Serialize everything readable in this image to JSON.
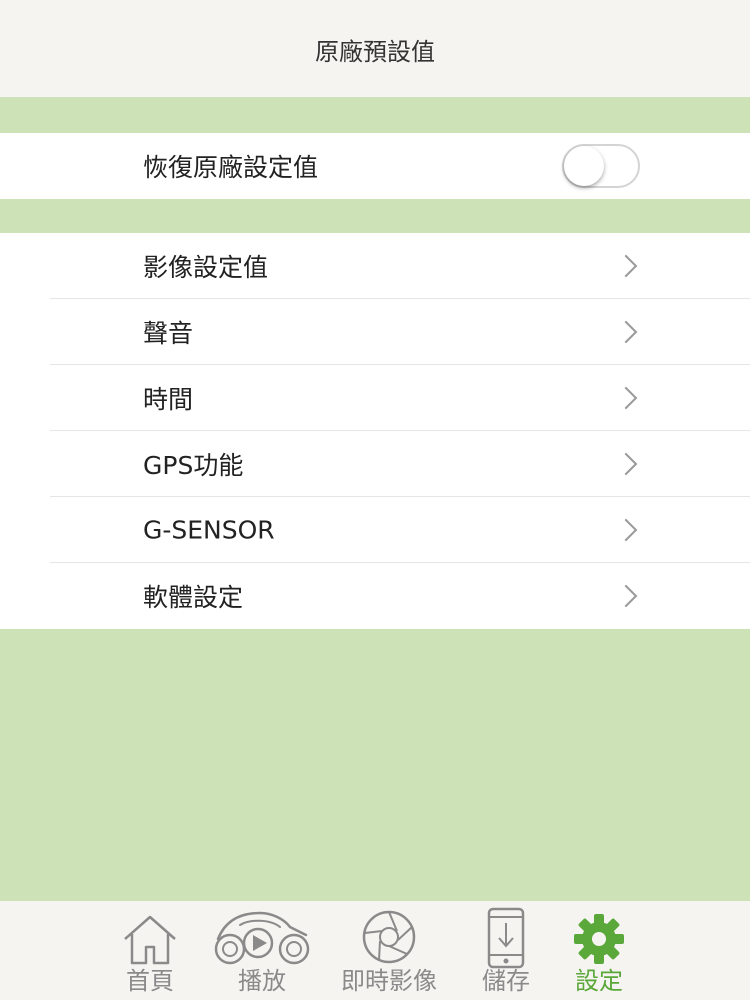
{
  "header": {
    "title": "原廠預設值"
  },
  "reset": {
    "label": "恢復原廠設定值",
    "enabled": false
  },
  "menu": {
    "items": [
      {
        "label": "影像設定值"
      },
      {
        "label": "聲音"
      },
      {
        "label": "時間"
      },
      {
        "label": "GPS功能"
      },
      {
        "label": "G-SENSOR"
      },
      {
        "label": "軟體設定"
      }
    ]
  },
  "tabbar": {
    "tabs": [
      {
        "label": "首頁",
        "icon": "home-icon"
      },
      {
        "label": "播放",
        "icon": "motorcycle-play-icon"
      },
      {
        "label": "即時影像",
        "icon": "aperture-icon"
      },
      {
        "label": "儲存",
        "icon": "phone-download-icon"
      },
      {
        "label": "設定",
        "icon": "gear-icon",
        "active": true
      }
    ]
  },
  "colors": {
    "background_green": "#cde3b7",
    "bar_background": "#f6f4f1",
    "active_green": "#5aa83a",
    "inactive_gray": "#8a8a8a"
  }
}
